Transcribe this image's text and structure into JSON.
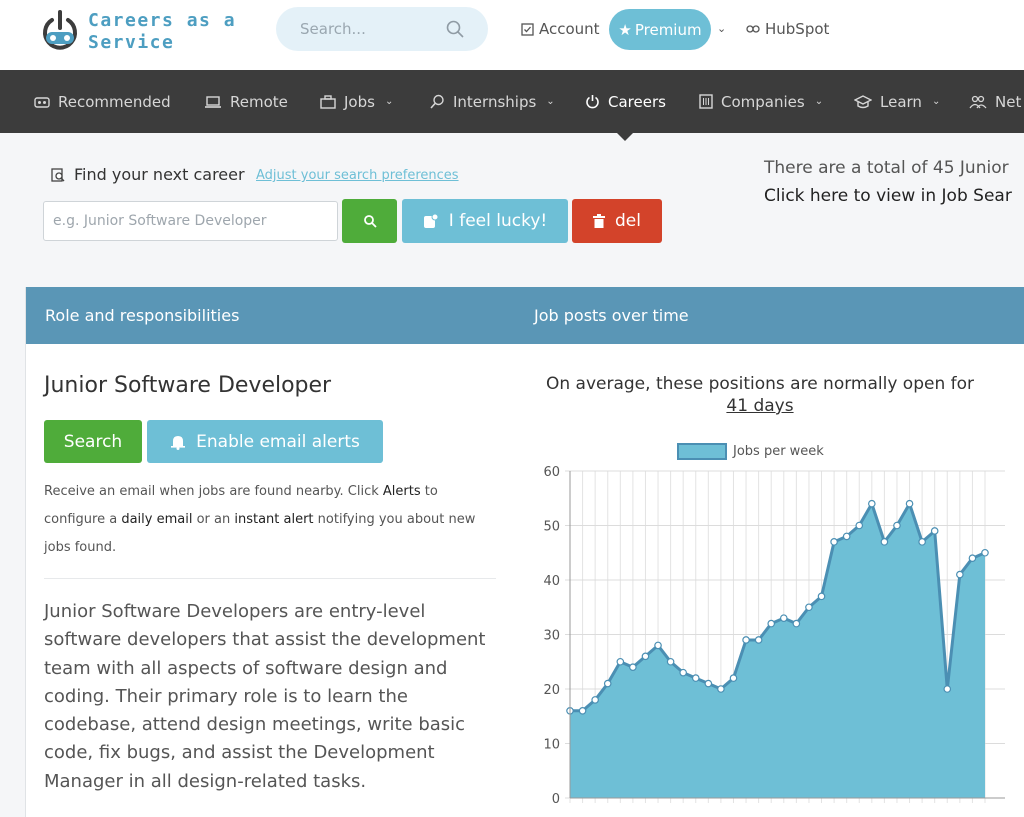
{
  "brand": {
    "line1": "Careers as a",
    "line2": "Service"
  },
  "header": {
    "search_placeholder": "Search...",
    "account": "Account",
    "premium": "Premium",
    "hubspot": "HubSpot"
  },
  "nav": {
    "recommended": "Recommended",
    "remote": "Remote",
    "jobs": "Jobs",
    "internships": "Internships",
    "careers": "Careers",
    "companies": "Companies",
    "learn": "Learn",
    "network": "Net"
  },
  "search": {
    "find_label": "Find your next career",
    "adjust_link": "Adjust your search preferences",
    "placeholder": "e.g. Junior Software Developer",
    "lucky": "I feel lucky!",
    "del": "del"
  },
  "summary": {
    "total": "There are a total of 45 Junior",
    "click": "Click here to view in Job Sear"
  },
  "panel": {
    "left_title": "Role and responsibilities",
    "right_title": "Job posts over time",
    "job_title": "Junior Software Developer",
    "search_btn": "Search",
    "alert_btn": "Enable email alerts",
    "alert_p1": "Receive an email when jobs are found nearby. Click ",
    "alert_alerts": "Alerts",
    "alert_p2": " to configure a ",
    "alert_daily": "daily email",
    "alert_p3": " or an ",
    "alert_instant": "instant alert",
    "alert_p4": " notifying you about new jobs found.",
    "description": "Junior Software Developers are entry-level software developers that assist the development team with all aspects of software design and coding. Their primary role is to learn the codebase, attend design meetings, write basic code, fix bugs, and assist the Development Manager in all design-related tasks.",
    "avg_text": "On average, these positions are normally open for",
    "avg_days": "41 days"
  },
  "chart_data": {
    "type": "area",
    "series": [
      {
        "name": "Jobs per week",
        "values": [
          16,
          16,
          18,
          21,
          25,
          24,
          26,
          28,
          25,
          23,
          22,
          21,
          20,
          22,
          29,
          29,
          32,
          33,
          32,
          35,
          37,
          47,
          48,
          50,
          54,
          47,
          50,
          54,
          47,
          49,
          20,
          41,
          44,
          45
        ]
      }
    ],
    "ylim": [
      0,
      60
    ],
    "yticks": [
      0,
      10,
      20,
      30,
      40,
      50,
      60
    ],
    "grid": true,
    "legend": "top",
    "color": "#6ebfd6",
    "stroke": "#4b8fb3"
  }
}
